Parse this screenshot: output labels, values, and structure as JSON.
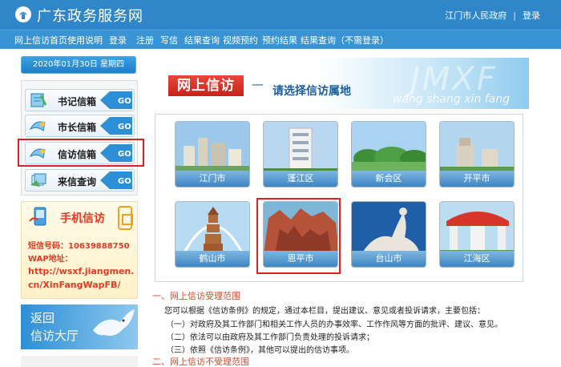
{
  "header": {
    "site_title": "广东政务服务网",
    "gov_link": "江门市人民政府",
    "separator": "|",
    "login": "登录"
  },
  "nav": {
    "items": [
      "网上信访首页",
      "使用说明",
      "登录",
      "注册",
      "写信",
      "结果查询",
      "视频预约",
      "预约结果",
      "结果查询（不需登录）"
    ]
  },
  "sidebar": {
    "date": "2020年01月30日 星期四",
    "mailboxes": [
      {
        "label": "书记信箱",
        "go": "GO"
      },
      {
        "label": "市长信箱",
        "go": "GO"
      },
      {
        "label": "信访信箱",
        "go": "GO"
      },
      {
        "label": "来信查询",
        "go": "GO"
      }
    ],
    "sms": {
      "title": "手机信访",
      "number_line": "短信号码：10639888750",
      "wap_label": "WAP地址：",
      "wap_url_1": "http://wsxf.jiangmen.",
      "wap_url_2": "cn/XinFangWapFB/"
    },
    "return_hall": {
      "line1": "返回",
      "line2": "信访大厅"
    }
  },
  "banner": {
    "title": "网上信访",
    "dash": "—",
    "subtitle": "请选择信访属地",
    "pinyin": "wang shang xin fang",
    "pinyin_big": "JMXF"
  },
  "districts": [
    {
      "name": "江门市"
    },
    {
      "name": "蓬江区"
    },
    {
      "name": "新会区"
    },
    {
      "name": "开平市"
    },
    {
      "name": "鹤山市"
    },
    {
      "name": "恩平市"
    },
    {
      "name": "台山市"
    },
    {
      "name": "江海区"
    }
  ],
  "content": {
    "section1_title": "一、网上信访受理范围",
    "intro": "您可以根据《信访条例》的规定，通过本栏目，提出建议、意见或者投诉请求，主要包括：",
    "items": [
      "（一）对政府及其工作部门和相关工作人员的办事效率、工作作风等方面的批评、建议、意见。",
      "（二）依法可以由政府及其工作部门负责处理的投诉请求；",
      "（三）依照《信访条例》，其他可以提出的信访事项。"
    ],
    "section2_title": "二、网上信访不受理范围"
  },
  "colors": {
    "header_blue": "#2f86c9",
    "nav_blue": "#3a93d2",
    "accent_red": "#e02020",
    "section_red": "#d24a2a"
  }
}
